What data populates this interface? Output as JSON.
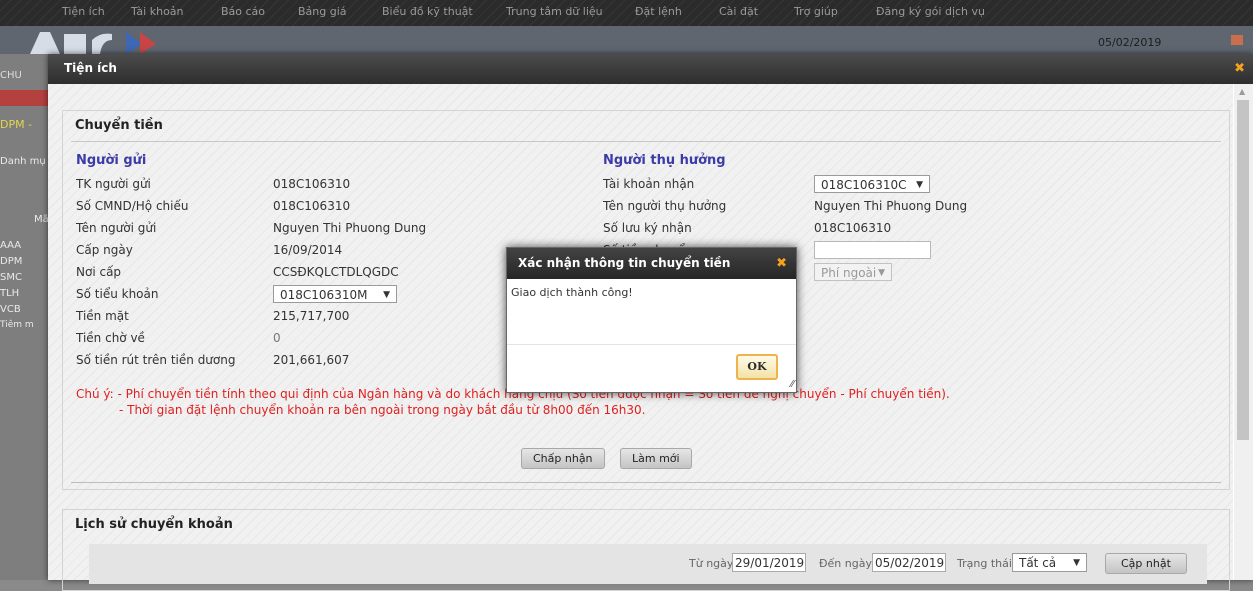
{
  "topnav": {
    "items": [
      "Tiện ích",
      "Tài khoản",
      "Báo cáo",
      "Bảng giá",
      "Biểu đồ kỹ thuật",
      "Trung tâm dữ liệu",
      "Đặt lệnh",
      "Cài đặt",
      "Trợ giúp",
      "Đăng ký gói dịch vụ"
    ]
  },
  "background": {
    "date": "05/02/2019",
    "left_labels": [
      "CHU",
      "DPM -",
      "Danh mụ",
      "Mã",
      "AAA",
      "DPM",
      "SMC",
      "TLH",
      "VCB",
      "Tiêm m"
    ]
  },
  "modal": {
    "title": "Tiện ích"
  },
  "transfer": {
    "title": "Chuyển tiền",
    "sender": {
      "heading": "Người gửi",
      "rows": [
        {
          "label": "TK người gửi",
          "value": "018C106310"
        },
        {
          "label": "Số CMND/Hộ chiếu",
          "value": "018C106310"
        },
        {
          "label": "Tên người gửi",
          "value": "Nguyen Thi Phuong Dung"
        },
        {
          "label": "Cấp ngày",
          "value": "16/09/2014"
        },
        {
          "label": "Nơi cấp",
          "value": "CCSĐKQLCTDLQGDC"
        },
        {
          "label": "Số tiểu khoản",
          "value": "018C106310M"
        },
        {
          "label": "Tiền mặt",
          "value": "215,717,700"
        },
        {
          "label": "Tiền chờ về",
          "value": "0"
        },
        {
          "label": "Số tiền rút trên tiền dương",
          "value": "201,661,607"
        }
      ]
    },
    "receiver": {
      "heading": "Người thụ hưởng",
      "rows": [
        {
          "label": "Tài khoản nhận",
          "value": "018C106310C"
        },
        {
          "label": "Tên người thụ hưởng",
          "value": "Nguyen Thi Phuong Dung"
        },
        {
          "label": "Số lưu ký nhận",
          "value": "018C106310"
        },
        {
          "label": "Số tiền chuyển",
          "value": ""
        },
        {
          "label": "",
          "value": "Phí ngoài"
        }
      ]
    },
    "note_1": "Chú ý: - Phí chuyển tiền tính theo qui định của Ngân hàng và do khách hàng chịu (Số tiền được nhận = Số tiền đề nghị chuyển - Phí chuyển tiền).",
    "note_2": "- Thời gian đặt lệnh chuyển khoản ra bên ngoài trong ngày bắt đầu từ 8h00 đến 16h30.",
    "accept_label": "Chấp nhận",
    "reset_label": "Làm mới"
  },
  "history": {
    "title": "Lịch sử chuyển khoản",
    "from_label": "Từ ngày",
    "from_value": "29/01/2019",
    "to_label": "Đến ngày",
    "to_value": "05/02/2019",
    "status_label": "Trạng thái",
    "status_value": "Tất cả",
    "update_label": "Cập nhật"
  },
  "dialog": {
    "title": "Xác nhận thông tin chuyển tiền",
    "message": "Giao dịch thành công!",
    "ok_label": "OK"
  },
  "colors": {
    "section_heading": "#3c3ca8",
    "note_red": "#e02020",
    "dialog_close": "#f7a21e",
    "ok_border": "#f0b24a"
  }
}
